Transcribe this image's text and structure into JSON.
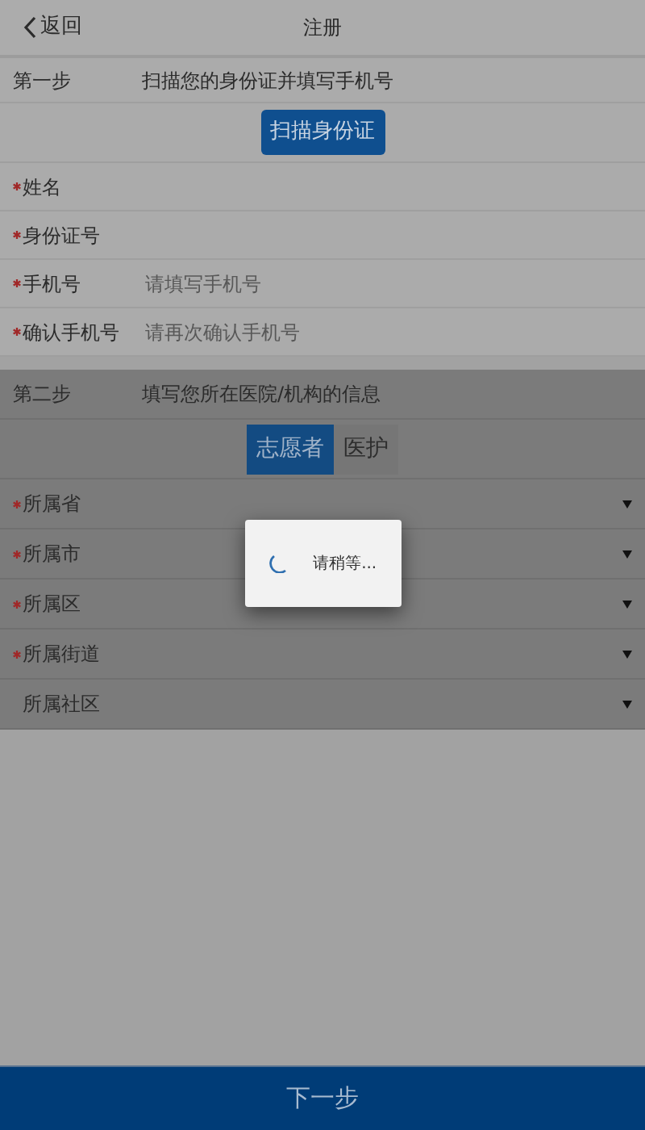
{
  "header": {
    "back_label": "返回",
    "title": "注册"
  },
  "step1": {
    "step": "第一步",
    "description": "扫描您的身份证并填写手机号",
    "scan_button": "扫描身份证",
    "fields": [
      {
        "label": "姓名",
        "required": true
      },
      {
        "label": "身份证号",
        "required": true
      },
      {
        "label": "手机号",
        "required": true,
        "placeholder": "请填写手机号"
      },
      {
        "label": "确认手机号",
        "required": true,
        "placeholder": "请再次确认手机号"
      }
    ]
  },
  "step2": {
    "step": "第二步",
    "description": "填写您所在医院/机构的信息",
    "role_tabs": [
      {
        "label": "志愿者",
        "selected": true
      },
      {
        "label": "医护",
        "selected": false
      }
    ],
    "selects": [
      {
        "label": "所属省",
        "required": true
      },
      {
        "label": "所属市",
        "required": true
      },
      {
        "label": "所属区",
        "required": true
      },
      {
        "label": "所属街道",
        "required": true
      },
      {
        "label": "所属社区",
        "required": false
      }
    ]
  },
  "loading": {
    "text": "请稍等..."
  },
  "next_button": "下一步"
}
